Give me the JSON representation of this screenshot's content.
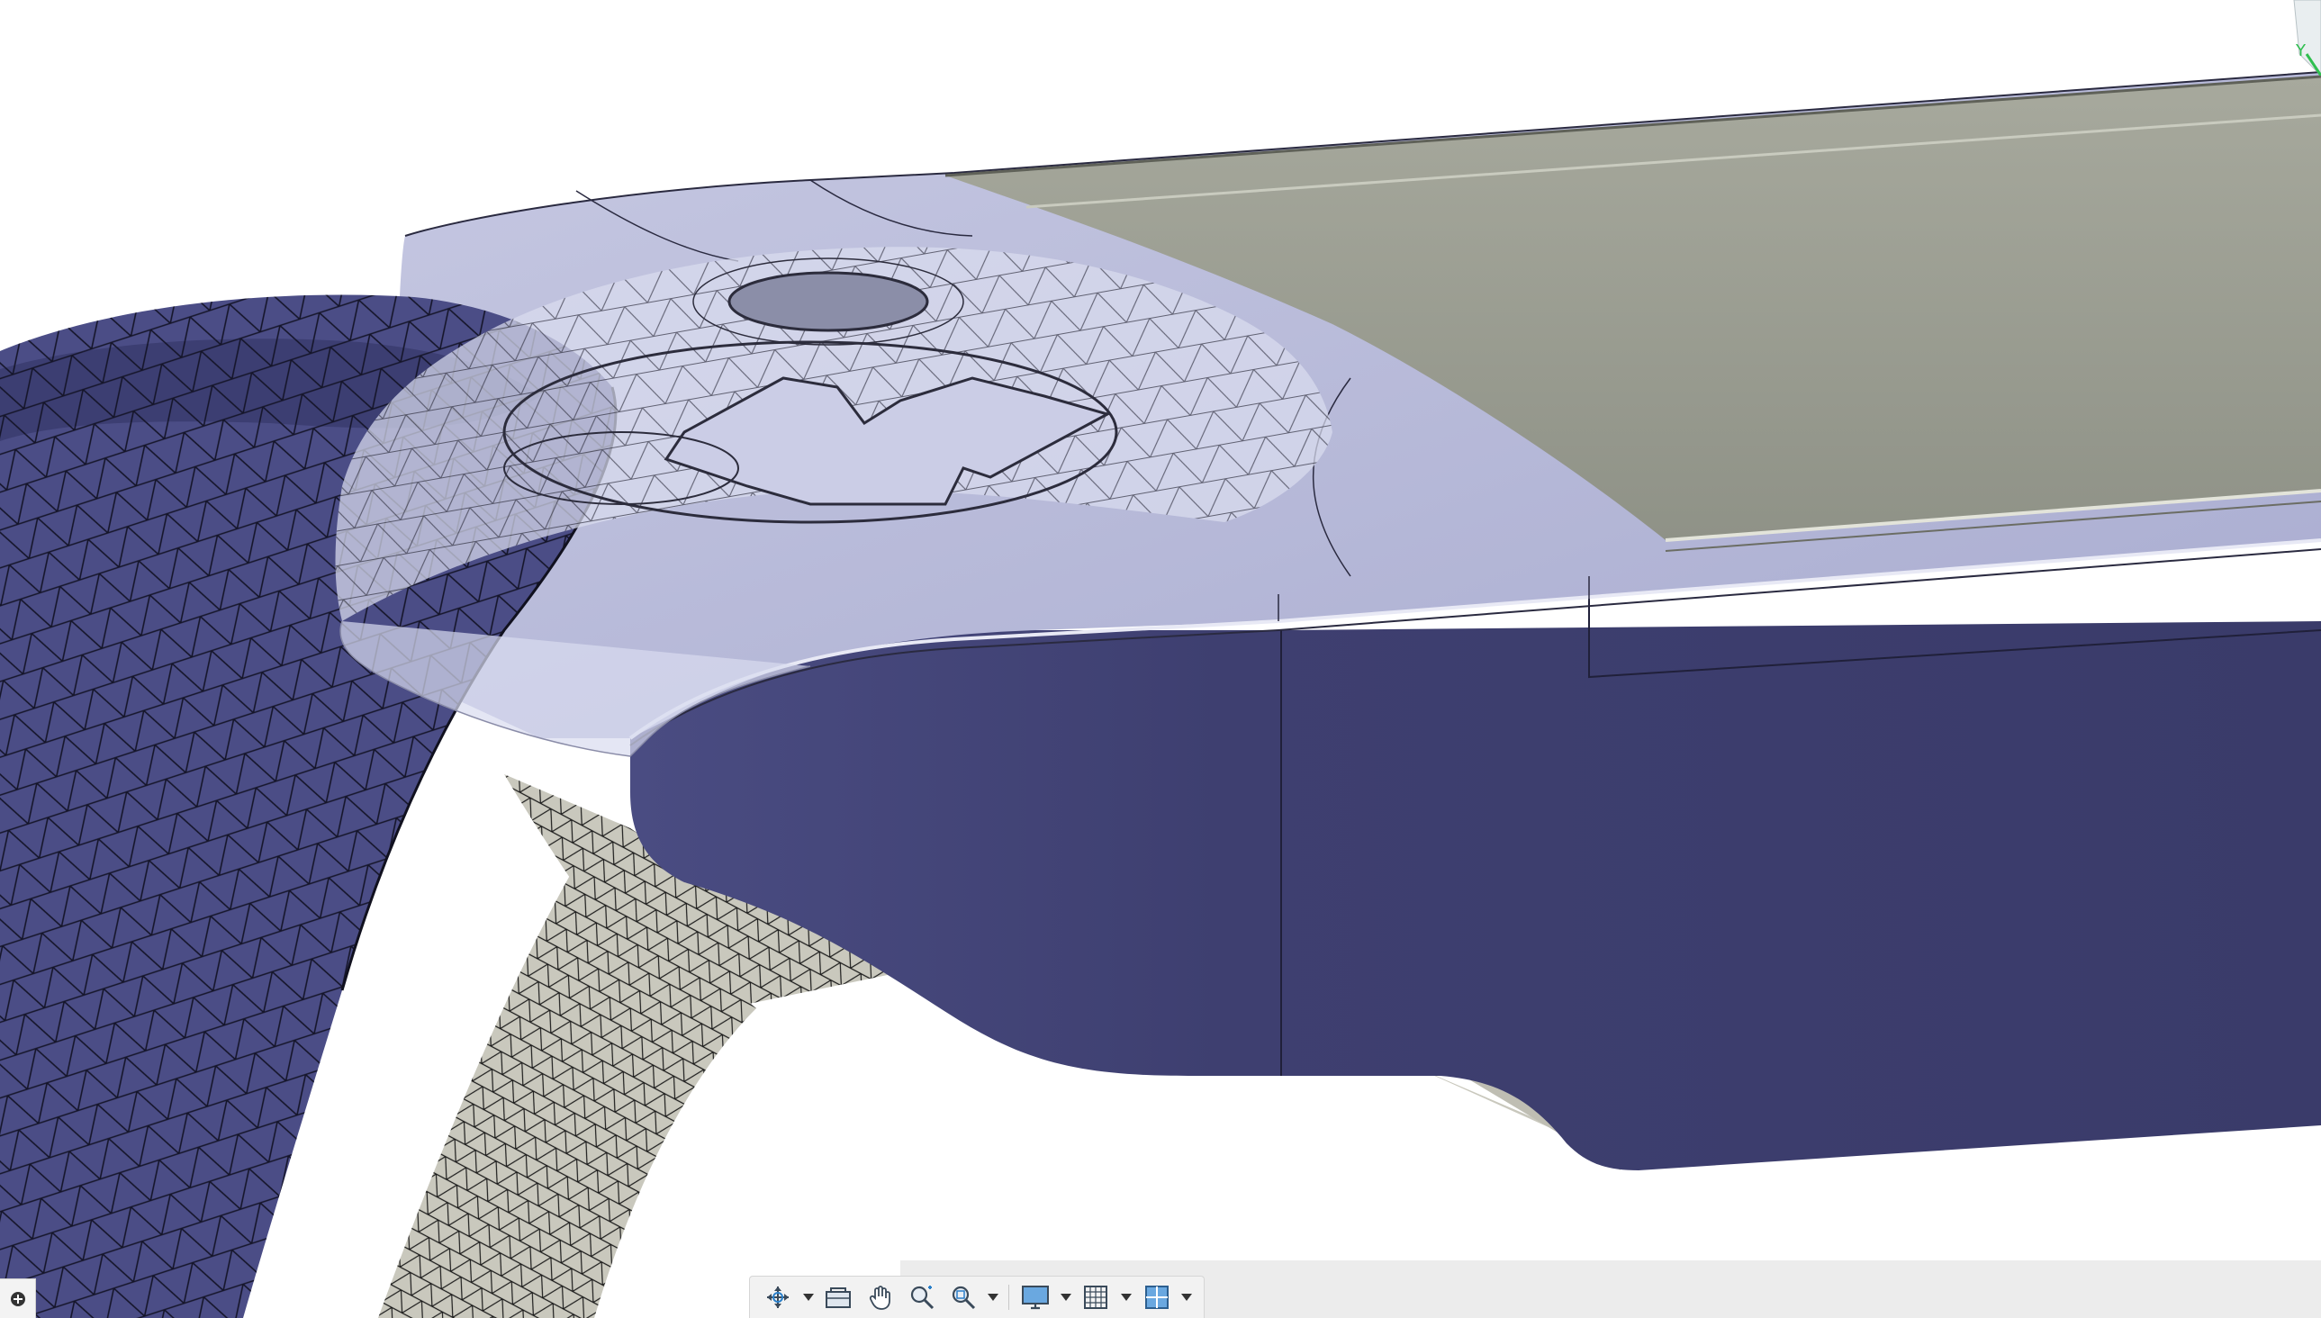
{
  "viewport": {
    "colors": {
      "body_blue": "#3f4072",
      "body_blue_light": "#5b5d94",
      "top_surface": "#b9bcdb",
      "translucent_cap": "#d9dcef",
      "screen_panel": "#9c9f94",
      "mesh_gray": "#c9c8bd",
      "mesh_line": "#1e1e2a"
    }
  },
  "toolbar": {
    "items": [
      {
        "name": "orbit-icon",
        "has_dropdown": true
      },
      {
        "name": "look-at-icon",
        "has_dropdown": false
      },
      {
        "name": "pan-icon",
        "has_dropdown": false
      },
      {
        "name": "zoom-icon",
        "has_dropdown": false
      },
      {
        "name": "fit-icon",
        "has_dropdown": true
      },
      {
        "name": "display-settings-icon",
        "has_dropdown": true
      },
      {
        "name": "grid-snap-icon",
        "has_dropdown": true
      },
      {
        "name": "viewports-icon",
        "has_dropdown": true
      }
    ]
  },
  "viewcube": {
    "axis_label": "Y"
  }
}
